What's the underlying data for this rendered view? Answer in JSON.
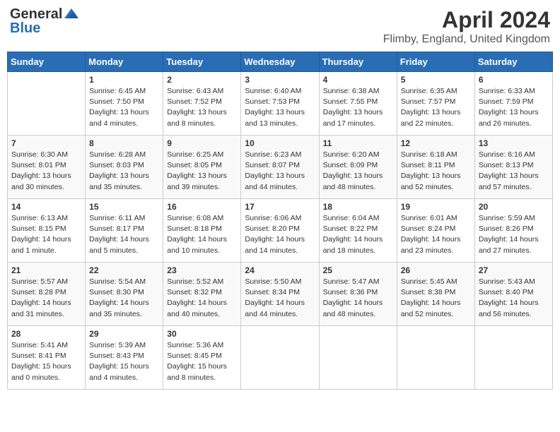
{
  "header": {
    "logo_general": "General",
    "logo_blue": "Blue",
    "title": "April 2024",
    "location": "Flimby, England, United Kingdom"
  },
  "days_of_week": [
    "Sunday",
    "Monday",
    "Tuesday",
    "Wednesday",
    "Thursday",
    "Friday",
    "Saturday"
  ],
  "weeks": [
    [
      {
        "day": "",
        "sunrise": "",
        "sunset": "",
        "daylight": ""
      },
      {
        "day": "1",
        "sunrise": "Sunrise: 6:45 AM",
        "sunset": "Sunset: 7:50 PM",
        "daylight": "Daylight: 13 hours and 4 minutes."
      },
      {
        "day": "2",
        "sunrise": "Sunrise: 6:43 AM",
        "sunset": "Sunset: 7:52 PM",
        "daylight": "Daylight: 13 hours and 8 minutes."
      },
      {
        "day": "3",
        "sunrise": "Sunrise: 6:40 AM",
        "sunset": "Sunset: 7:53 PM",
        "daylight": "Daylight: 13 hours and 13 minutes."
      },
      {
        "day": "4",
        "sunrise": "Sunrise: 6:38 AM",
        "sunset": "Sunset: 7:55 PM",
        "daylight": "Daylight: 13 hours and 17 minutes."
      },
      {
        "day": "5",
        "sunrise": "Sunrise: 6:35 AM",
        "sunset": "Sunset: 7:57 PM",
        "daylight": "Daylight: 13 hours and 22 minutes."
      },
      {
        "day": "6",
        "sunrise": "Sunrise: 6:33 AM",
        "sunset": "Sunset: 7:59 PM",
        "daylight": "Daylight: 13 hours and 26 minutes."
      }
    ],
    [
      {
        "day": "7",
        "sunrise": "Sunrise: 6:30 AM",
        "sunset": "Sunset: 8:01 PM",
        "daylight": "Daylight: 13 hours and 30 minutes."
      },
      {
        "day": "8",
        "sunrise": "Sunrise: 6:28 AM",
        "sunset": "Sunset: 8:03 PM",
        "daylight": "Daylight: 13 hours and 35 minutes."
      },
      {
        "day": "9",
        "sunrise": "Sunrise: 6:25 AM",
        "sunset": "Sunset: 8:05 PM",
        "daylight": "Daylight: 13 hours and 39 minutes."
      },
      {
        "day": "10",
        "sunrise": "Sunrise: 6:23 AM",
        "sunset": "Sunset: 8:07 PM",
        "daylight": "Daylight: 13 hours and 44 minutes."
      },
      {
        "day": "11",
        "sunrise": "Sunrise: 6:20 AM",
        "sunset": "Sunset: 8:09 PM",
        "daylight": "Daylight: 13 hours and 48 minutes."
      },
      {
        "day": "12",
        "sunrise": "Sunrise: 6:18 AM",
        "sunset": "Sunset: 8:11 PM",
        "daylight": "Daylight: 13 hours and 52 minutes."
      },
      {
        "day": "13",
        "sunrise": "Sunrise: 6:16 AM",
        "sunset": "Sunset: 8:13 PM",
        "daylight": "Daylight: 13 hours and 57 minutes."
      }
    ],
    [
      {
        "day": "14",
        "sunrise": "Sunrise: 6:13 AM",
        "sunset": "Sunset: 8:15 PM",
        "daylight": "Daylight: 14 hours and 1 minute."
      },
      {
        "day": "15",
        "sunrise": "Sunrise: 6:11 AM",
        "sunset": "Sunset: 8:17 PM",
        "daylight": "Daylight: 14 hours and 5 minutes."
      },
      {
        "day": "16",
        "sunrise": "Sunrise: 6:08 AM",
        "sunset": "Sunset: 8:18 PM",
        "daylight": "Daylight: 14 hours and 10 minutes."
      },
      {
        "day": "17",
        "sunrise": "Sunrise: 6:06 AM",
        "sunset": "Sunset: 8:20 PM",
        "daylight": "Daylight: 14 hours and 14 minutes."
      },
      {
        "day": "18",
        "sunrise": "Sunrise: 6:04 AM",
        "sunset": "Sunset: 8:22 PM",
        "daylight": "Daylight: 14 hours and 18 minutes."
      },
      {
        "day": "19",
        "sunrise": "Sunrise: 6:01 AM",
        "sunset": "Sunset: 8:24 PM",
        "daylight": "Daylight: 14 hours and 23 minutes."
      },
      {
        "day": "20",
        "sunrise": "Sunrise: 5:59 AM",
        "sunset": "Sunset: 8:26 PM",
        "daylight": "Daylight: 14 hours and 27 minutes."
      }
    ],
    [
      {
        "day": "21",
        "sunrise": "Sunrise: 5:57 AM",
        "sunset": "Sunset: 8:28 PM",
        "daylight": "Daylight: 14 hours and 31 minutes."
      },
      {
        "day": "22",
        "sunrise": "Sunrise: 5:54 AM",
        "sunset": "Sunset: 8:30 PM",
        "daylight": "Daylight: 14 hours and 35 minutes."
      },
      {
        "day": "23",
        "sunrise": "Sunrise: 5:52 AM",
        "sunset": "Sunset: 8:32 PM",
        "daylight": "Daylight: 14 hours and 40 minutes."
      },
      {
        "day": "24",
        "sunrise": "Sunrise: 5:50 AM",
        "sunset": "Sunset: 8:34 PM",
        "daylight": "Daylight: 14 hours and 44 minutes."
      },
      {
        "day": "25",
        "sunrise": "Sunrise: 5:47 AM",
        "sunset": "Sunset: 8:36 PM",
        "daylight": "Daylight: 14 hours and 48 minutes."
      },
      {
        "day": "26",
        "sunrise": "Sunrise: 5:45 AM",
        "sunset": "Sunset: 8:38 PM",
        "daylight": "Daylight: 14 hours and 52 minutes."
      },
      {
        "day": "27",
        "sunrise": "Sunrise: 5:43 AM",
        "sunset": "Sunset: 8:40 PM",
        "daylight": "Daylight: 14 hours and 56 minutes."
      }
    ],
    [
      {
        "day": "28",
        "sunrise": "Sunrise: 5:41 AM",
        "sunset": "Sunset: 8:41 PM",
        "daylight": "Daylight: 15 hours and 0 minutes."
      },
      {
        "day": "29",
        "sunrise": "Sunrise: 5:39 AM",
        "sunset": "Sunset: 8:43 PM",
        "daylight": "Daylight: 15 hours and 4 minutes."
      },
      {
        "day": "30",
        "sunrise": "Sunrise: 5:36 AM",
        "sunset": "Sunset: 8:45 PM",
        "daylight": "Daylight: 15 hours and 8 minutes."
      },
      {
        "day": "",
        "sunrise": "",
        "sunset": "",
        "daylight": ""
      },
      {
        "day": "",
        "sunrise": "",
        "sunset": "",
        "daylight": ""
      },
      {
        "day": "",
        "sunrise": "",
        "sunset": "",
        "daylight": ""
      },
      {
        "day": "",
        "sunrise": "",
        "sunset": "",
        "daylight": ""
      }
    ]
  ]
}
